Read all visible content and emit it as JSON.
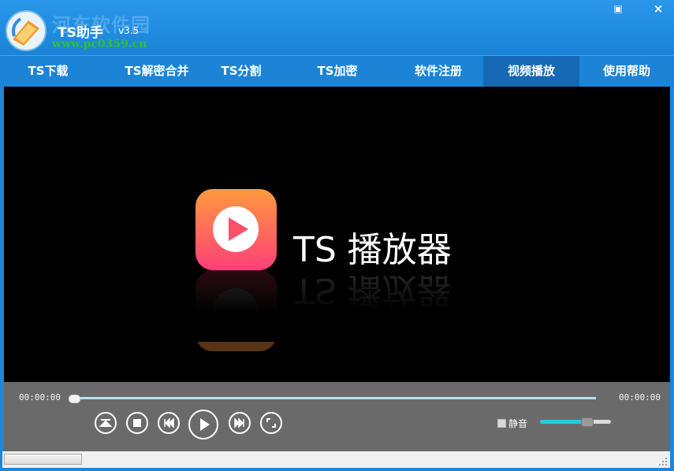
{
  "window": {
    "title": "TS助手",
    "version": "v3.5",
    "minimize_glyph": "▣",
    "close_glyph": "×"
  },
  "watermark": {
    "site_name": "河东软件园",
    "url": "www.pc0359.cn"
  },
  "tabs": [
    {
      "label": "TS下载",
      "active": false
    },
    {
      "label": "TS解密合并",
      "active": false
    },
    {
      "label": "TS分割",
      "active": false
    },
    {
      "label": "TS加密",
      "active": false
    },
    {
      "label": "软件注册",
      "active": false
    },
    {
      "label": "视频播放",
      "active": true
    },
    {
      "label": "使用帮助",
      "active": false
    }
  ],
  "player": {
    "brand": "TS 播放器",
    "logo_colors": [
      "#ff9a3c",
      "#ff3f7a"
    ],
    "current_time": "00:00:00",
    "total_time": "00:00:00",
    "progress": 0,
    "volume": 0.65,
    "mute_label": "静音",
    "muted": false,
    "buttons": [
      "eject-icon",
      "stop-icon",
      "previous-icon",
      "play-icon",
      "next-icon",
      "fullscreen-icon"
    ]
  },
  "colors": {
    "accent": "#1f86d8",
    "active_tab": "#1569b4",
    "volume": "#28c8e4",
    "seek": "#b9e1ef"
  }
}
